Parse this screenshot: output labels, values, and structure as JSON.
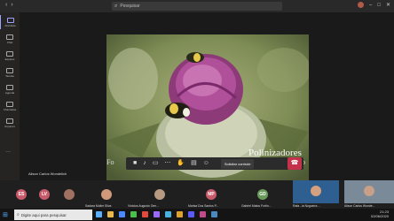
{
  "search": {
    "placeholder": "Pesquisar"
  },
  "sidebar": {
    "items": [
      "Atividade",
      "Chat",
      "Equipes",
      "Tarefas",
      "Agenda",
      "Chamadas",
      "Arquivos"
    ],
    "more": "···"
  },
  "slide": {
    "title": "Polinizadores",
    "subtitle_left": "Fo",
    "subtitle_right": "o"
  },
  "presenter_name": "Alison Carlos Wondelich",
  "controls": {
    "request_control": "Solicitar controle"
  },
  "participants": [
    {
      "initials": "ES",
      "name": "",
      "color": "#c95a6a"
    },
    {
      "initials": "LV",
      "name": "",
      "color": "#c95a6a"
    },
    {
      "initials": "",
      "name": "Sadara Moller Silva",
      "color": "#d09a7a"
    },
    {
      "initials": "",
      "name": "Vinicius Augusto Oen...",
      "color": "#b89a80"
    },
    {
      "initials": "MP",
      "name": "Marisa Dos Santos P...",
      "color": "#c95a6a"
    },
    {
      "initials": "GD",
      "name": "Gabriel Matos Fortin...",
      "color": "#6a9a5a"
    },
    {
      "initials": "",
      "name": "Rafa...ia Nogueira ...",
      "color": "#3a80c0"
    },
    {
      "initials": "",
      "name": "Alison Carlos Wonde...",
      "color": "#6a8aa8"
    }
  ],
  "taskbar": {
    "search_placeholder": "Digite aqui para pesquisar",
    "time": "21:23",
    "date": "02/06/2020",
    "icon_colors": [
      "#5ab0ff",
      "#e8b84a",
      "#4a8aff",
      "#4ac04a",
      "#e04a3a",
      "#9a6aff",
      "#4ab0e0",
      "#e0a030",
      "#5a5aff",
      "#c04a8a",
      "#4a8ac0"
    ]
  }
}
